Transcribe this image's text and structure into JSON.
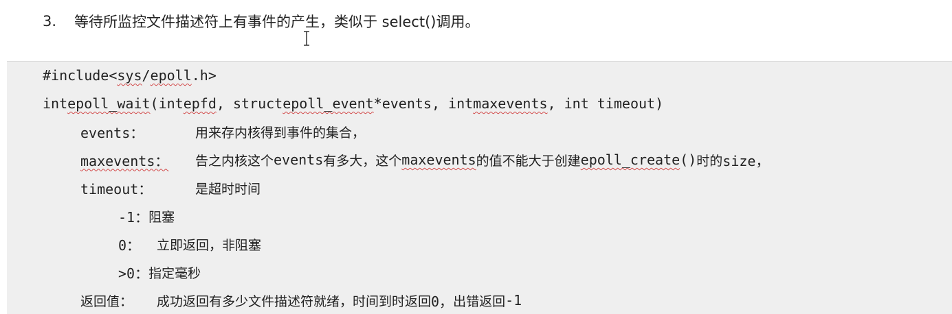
{
  "heading": {
    "number": "3.",
    "text": "等待所监控文件描述符上有事件的产生，类似于 select()调用。"
  },
  "code": {
    "include": {
      "directive": "#include ",
      "header_open": "<",
      "header_sys": "sys",
      "header_sep": "/",
      "header_file": "epoll",
      "header_close": ".h>"
    },
    "signature": {
      "t1": "int ",
      "fn": "epoll_wait",
      "t2": "(int ",
      "epfd": "epfd",
      "t3": ", struct ",
      "epoll_event": "epoll_event",
      "t4": " *events, int ",
      "maxevents": "maxevents",
      "t5": ", int timeout)"
    },
    "params": {
      "events_label": "events：",
      "events_desc": "用来存内核得到事件的集合，",
      "maxevents_label": "maxevents：",
      "maxevents_desc_1": "告之内核这个",
      "maxevents_code_1": " events ",
      "maxevents_desc_2": "有多大，这个",
      "maxevents_code_2": "maxevents",
      "maxevents_desc_3": " 的值不能大于创建",
      "maxevents_code_3": "epoll_create",
      "maxevents_code_4": "()",
      "maxevents_desc_4": "时的",
      "maxevents_code_5": " size，",
      "timeout_label": "timeout：",
      "timeout_desc": "是超时时间"
    },
    "timeout_values": [
      {
        "key": "-1：",
        "desc": "阻塞"
      },
      {
        "key": "0：",
        "desc": "立即返回，非阻塞"
      },
      {
        "key": ">0：",
        "desc": "指定毫秒"
      }
    ],
    "return": {
      "label": "返回值：",
      "desc_1": "成功返回有多少文件描述符就绪，时间到时返回",
      "code_1": " 0，",
      "desc_2": "出错返回",
      "code_2": "-1"
    }
  }
}
